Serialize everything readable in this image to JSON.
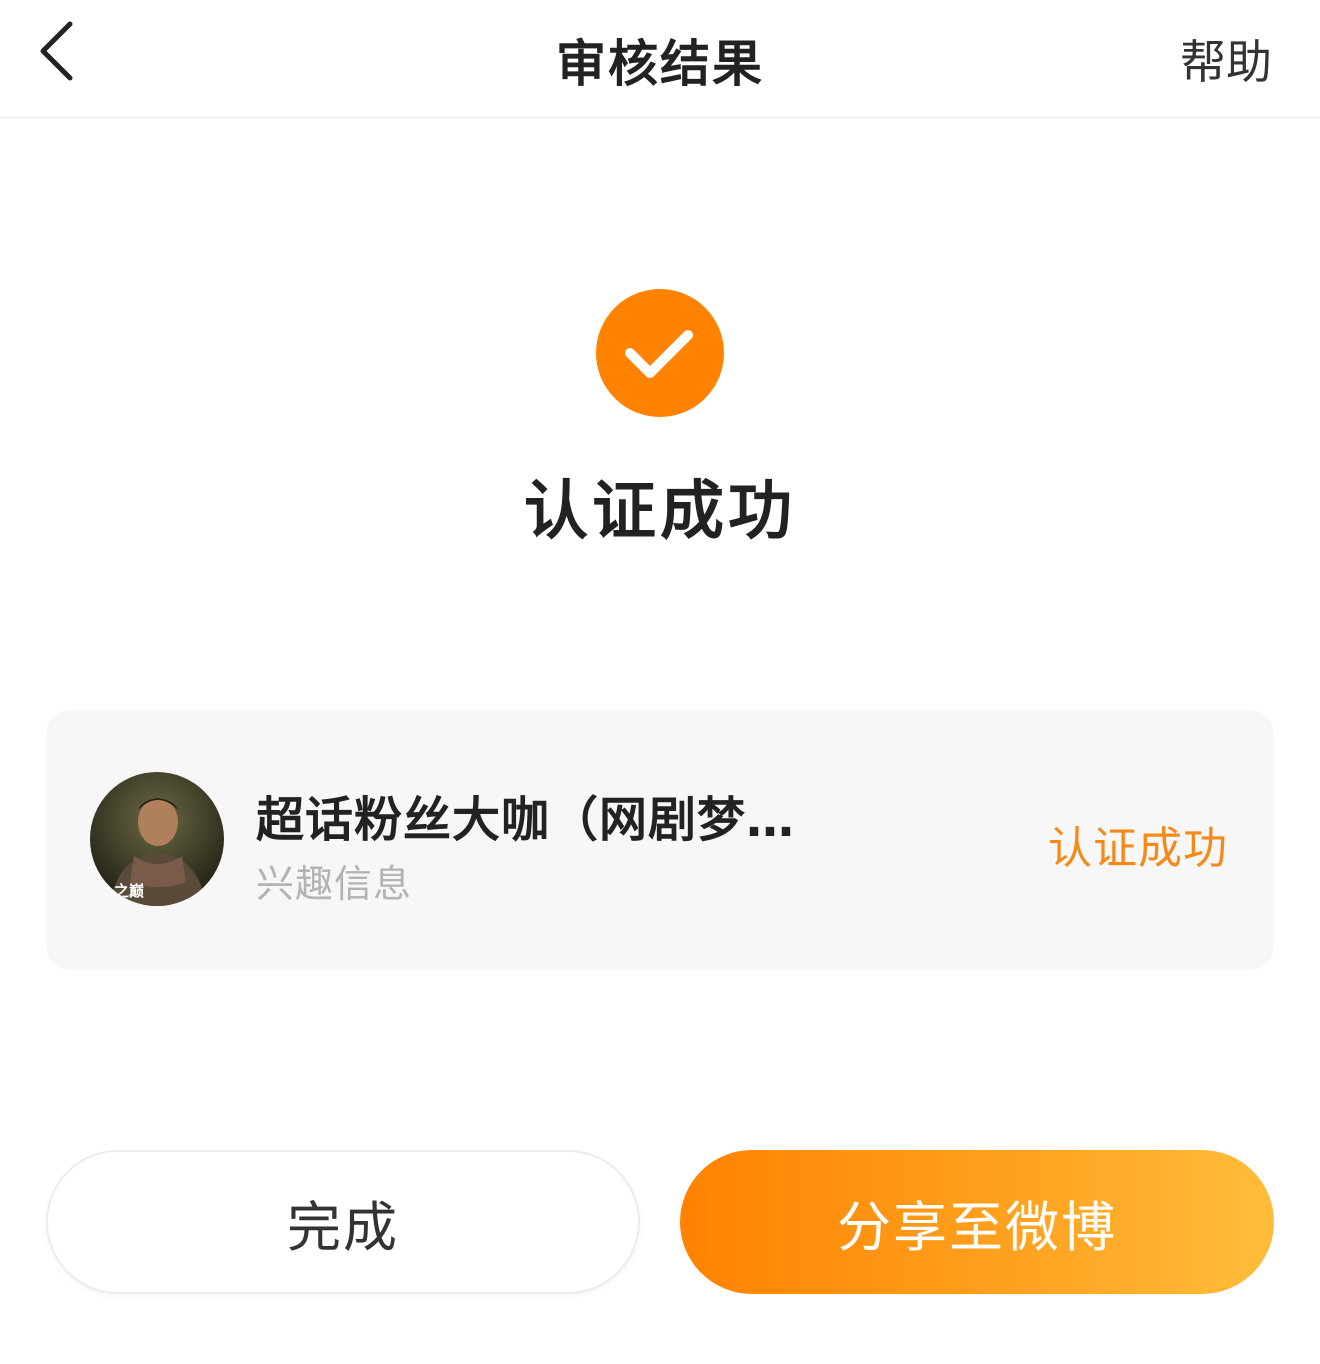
{
  "header": {
    "title": "审核结果",
    "help_label": "帮助"
  },
  "result": {
    "title": "认证成功",
    "accent_color": "#FF8200"
  },
  "card": {
    "title": "超话粉丝大咖（网剧梦…",
    "subtitle": "兴趣信息",
    "status": "认证成功",
    "avatar_text": "之巅"
  },
  "buttons": {
    "done_label": "完成",
    "share_label": "分享至微博"
  }
}
